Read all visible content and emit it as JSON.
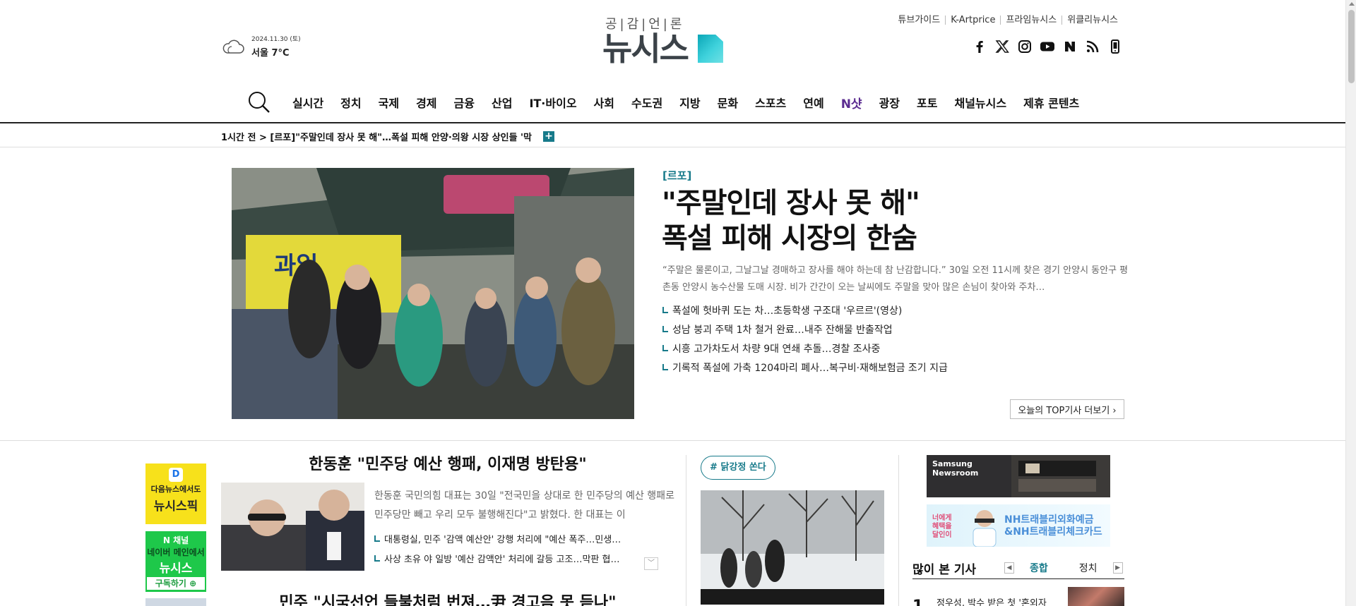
{
  "weather": {
    "date": "2024.11.30 (토)",
    "temp": "서울 7°C",
    "icon": "cloud-icon"
  },
  "logo": {
    "slogan": "공|감|언|론",
    "name": "뉴시스"
  },
  "top_links": [
    "튜브가이드",
    "K-Artprice",
    "프라임뉴시스",
    "위클리뉴시스"
  ],
  "social_icons": [
    "facebook-icon",
    "x-icon",
    "instagram-icon",
    "youtube-icon",
    "naver-icon",
    "rss-icon",
    "mobile-icon"
  ],
  "nav": {
    "items": [
      "실시간",
      "정치",
      "국제",
      "경제",
      "금융",
      "산업",
      "IT·바이오",
      "사회",
      "수도권",
      "지방",
      "문화",
      "스포츠",
      "연예",
      "N샷",
      "광장",
      "포토",
      "채널뉴시스",
      "제휴 콘텐츠"
    ]
  },
  "ticker": {
    "text": "1시간 전 > [르포]\"주말인데 장사 못 해\"…폭설 피해 안양·의왕 시장 상인들 '막",
    "plus": "+"
  },
  "hero": {
    "tag": "[르포]",
    "title_line1": "\"주말인데 장사 못 해\"",
    "title_line2": "폭설 피해 시장의 한숨",
    "summary": "“주말은 물론이고, 그날그날 경매하고 장사를 해야 하는데 참 난감합니다.” 30일 오전 11시께 찾은 경기 안양시 동안구 평촌동 안양시 농수산물 도매 시장. 비가 간간이 오는 날씨에도 주말을 맞아 많은 손님이 찾아와 주차…",
    "related": [
      "폭설에 헛바퀴 도는 차…초등학생 구조대 '우르르'(영상)",
      "성남 붕괴 주택 1차 철거 완료…내주 잔해물 반출작업",
      "시흥 고가차도서 차량 9대 연쇄 추돌…경찰 조사중",
      "기록적 폭설에 가축 1204마리 폐사…복구비·재해보험금 조기 지급"
    ],
    "more": "오늘의 TOP기사 더보기 ›"
  },
  "banners": {
    "daum_line1": "다음뉴스에서도",
    "daum_line2": "뉴시스픽",
    "naver_line1": "N 채널",
    "naver_line2": "네이버 메인에서",
    "naver_line3": "뉴시스",
    "naver_sub": "구독하기 ⊕"
  },
  "center": {
    "title1": "한동훈 \"민주당 예산 행패, 이재명 방탄용\"",
    "summary1": "한동훈 국민의힘 대표는 30일 \"전국민을 상대로 한 민주당의 예산 행패로 민주당만 빼고 우리 모두 불행해진다\"고 밝혔다. 한 대표는 이",
    "related1": [
      "대통령실, 민주 '감액 예산안' 강행 처리에 \"예산 폭주…민생…",
      "사상 초유 야 일방 '예산 감액안' 처리에 갈등 고조…막판 협…"
    ],
    "toggle": "﹀",
    "title2": "민주 \"시국선언 들불처럼 번져…尹 경고음 못 듣나\""
  },
  "hashtag": "# 닭강정 쏜다",
  "ads": {
    "samsung": "Samsung\nNewsroom",
    "nh_small": "너에게\n혜택을\n달인이",
    "nh_main": "NH트래블리외화예금\n&NH트래블리체크카드"
  },
  "popular": {
    "title": "많이 본 기사",
    "tabs": [
      "종합",
      "정치"
    ],
    "active_tab": "종합",
    "items": [
      {
        "rank": "1",
        "text": "정우성, 박수 받은 첫 '혼외자"
      }
    ]
  },
  "colors": {
    "accent": "#177a8a",
    "logo_gradient": "#3fd2dc"
  }
}
